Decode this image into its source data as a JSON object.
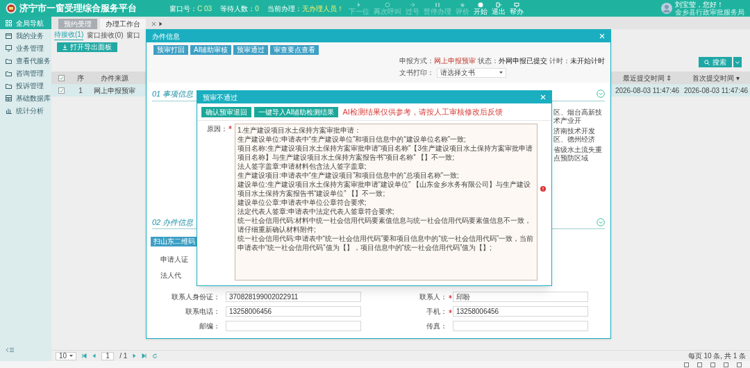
{
  "header": {
    "title": "济宁市一窗受理综合服务平台",
    "stats": [
      {
        "label": "窗口号：",
        "value": "C 03"
      },
      {
        "label": "等待人数：",
        "value": "0"
      },
      {
        "label": "当前办理：",
        "value": "无办理人员！"
      }
    ],
    "toolbar": [
      {
        "label": "下一位",
        "disabled": true
      },
      {
        "label": "再次呼叫",
        "disabled": true
      },
      {
        "label": "过号",
        "disabled": true
      },
      {
        "label": "暂停办理",
        "disabled": true
      },
      {
        "label": "评价",
        "disabled": true
      },
      {
        "label": "开始",
        "disabled": false
      },
      {
        "label": "退出",
        "disabled": false
      },
      {
        "label": "帮办",
        "disabled": false
      }
    ],
    "user": {
      "greeting": "刘宝莹，您好！",
      "org": "金乡县行政审批服务局"
    }
  },
  "sidebar": {
    "items": [
      {
        "label": "全局导航",
        "selected": true
      },
      {
        "label": "我的业务",
        "selected": false
      },
      {
        "label": "业务管理",
        "selected": false
      },
      {
        "label": "查看代服务",
        "selected": false
      },
      {
        "label": "咨询管理",
        "selected": false
      },
      {
        "label": "投诉管理",
        "selected": false
      },
      {
        "label": "基础数据库",
        "selected": false
      },
      {
        "label": "统计分析",
        "selected": false
      }
    ]
  },
  "tabs": [
    {
      "label": "预约受理",
      "selected": false
    },
    {
      "label": "办理工作台",
      "selected": true
    }
  ],
  "subtabs": [
    {
      "label": "待接收(1)",
      "selected": true
    },
    {
      "label": "窗口接收(0)",
      "selected": false
    },
    {
      "label": "窗口",
      "selected": false
    }
  ],
  "export_button": "打开导出面板",
  "search_button": "搜索",
  "table": {
    "columns": [
      "序",
      "办件来源",
      "最近提交时间 ⇕",
      "首次提交时间 ▾"
    ],
    "rows": [
      {
        "checked": true,
        "cells": [
          "1",
          "网上申报预审",
          "2026-08-03 11:47:46",
          "2026-08-03 11:47:46"
        ]
      }
    ]
  },
  "pagination": {
    "page_size": "10",
    "page": "1",
    "total": "/ 1",
    "summary": "每页 10 条, 共 1 条"
  },
  "case_dialog": {
    "title": "办件信息",
    "buttons": [
      "预审打回",
      "AI辅助审核",
      "预审通过",
      "审查要点查看"
    ],
    "info": [
      {
        "label": "申报方式：",
        "value": "网上申报预审"
      },
      {
        "label": "状态：",
        "value": "外网申报已提交"
      },
      {
        "label": "计时：",
        "value": "未开始计时"
      }
    ],
    "print": {
      "label": "文书打印：",
      "placeholder": "请选择文书"
    },
    "section_1": {
      "title": "01 事项信息",
      "fragments": [
        "区、烟台高新技术产业开",
        "济南技术开发区、德州经济",
        "省级水土流失重点预防区域"
      ]
    },
    "section_2": {
      "title": "02 办件信息",
      "scan_button": "扫山东二维码",
      "covered_labels": [
        "申请人证",
        "法人代"
      ],
      "fields": [
        {
          "label": "联系人身份证：",
          "value": "370828199002022911",
          "required": false
        },
        {
          "label": "联系人：",
          "value": "邱盼",
          "required": true
        },
        {
          "label": "联系电话：",
          "value": "13258006456",
          "required": false
        },
        {
          "label": "手机：",
          "value": "13258006456",
          "required": true
        },
        {
          "label": "邮编：",
          "required": false
        },
        {
          "label": "传真：",
          "required": false
        }
      ]
    }
  },
  "reject_dialog": {
    "title": "预审不通过",
    "buttons": [
      "确认预审退回",
      "一键导入AI辅助检测结果"
    ],
    "warning": "AI检测结果仅供参考，请按人工审核修改后反馈",
    "reason_label": "原因：",
    "reason_required": true,
    "reason_lines": [
      "1.生产建设项目水土保持方案审批申请：",
      "生产建设单位:申请表中“生产建设单位”和项目信息中的“建设单位名称”一致;",
      "项目名称:生产建设项目水土保持方案审批申请“项目名称”【3生产建设项目水土保持方案审批申请项目名称】与生产建设项目水土保持方案报告书“项目名称” 【】不一致;",
      "法人签字盖章:申请材料包含法人签字盖章;",
      "生产建设项目:申请表中“生产建设项目”和项目信息中的“总项目名称”一致;",
      "建设单位:生产建设项目水土保持方案审批申请“建设单位” 【山东金乡水务有限公司】与生产建设项目水土保持方案报告书“建设单位” 【】不一致;",
      "建设单位公章:申请表中单位公章符合要求;",
      "法定代表人签章:申请表中法定代表人签章符合要求;",
      "统一社会信用代码:材料中统一社会信用代码要素值信息与统一社会信用代码要素值信息不一致，请仔细重新确认材料附件;",
      "统一社会信用代码:申请表中“统一社会信用代码”要和项目信息中的“统一社会信用代码”一致，当前申请表中“统一社会信用代码”值为【】，项目信息中的“统一社会信用代码”值为【】;"
    ]
  }
}
